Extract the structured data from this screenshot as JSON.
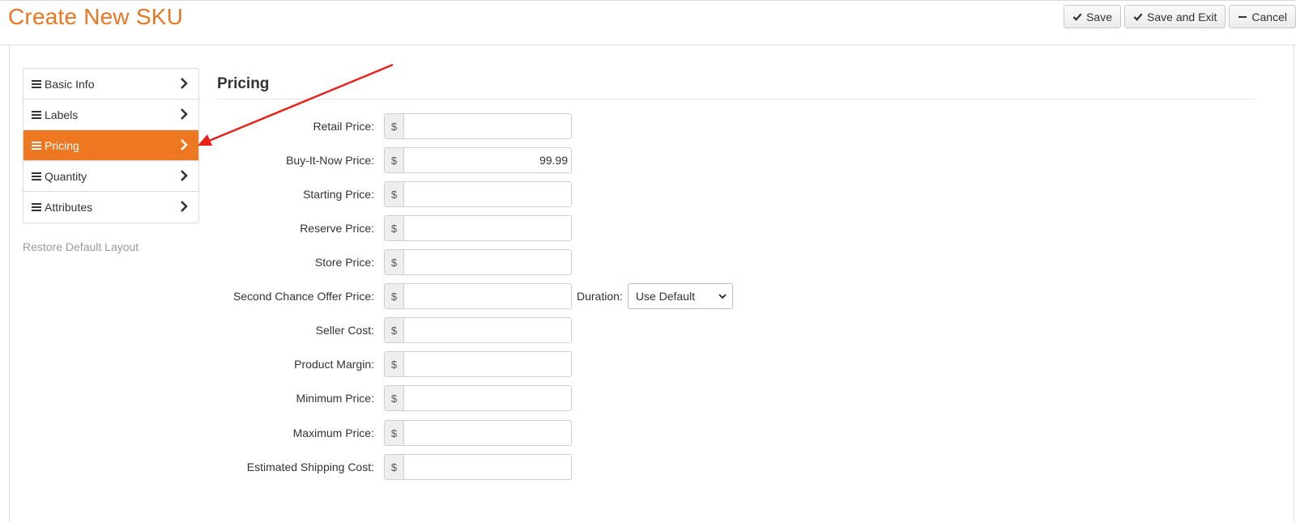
{
  "header": {
    "title": "Create New SKU",
    "save_label": "Save",
    "save_exit_label": "Save and Exit",
    "cancel_label": "Cancel"
  },
  "sidebar": {
    "items": [
      {
        "label": "Basic Info",
        "active": false
      },
      {
        "label": "Labels",
        "active": false
      },
      {
        "label": "Pricing",
        "active": true
      },
      {
        "label": "Quantity",
        "active": false
      },
      {
        "label": "Attributes",
        "active": false
      }
    ],
    "restore_label": "Restore Default Layout",
    "accent_color": "#ee7722"
  },
  "section": {
    "title": "Pricing"
  },
  "fields": [
    {
      "label": "Retail Price:",
      "currency": "$",
      "value": ""
    },
    {
      "label": "Buy-It-Now Price:",
      "currency": "$",
      "value": "99.99"
    },
    {
      "label": "Starting Price:",
      "currency": "$",
      "value": ""
    },
    {
      "label": "Reserve Price:",
      "currency": "$",
      "value": ""
    },
    {
      "label": "Store Price:",
      "currency": "$",
      "value": ""
    },
    {
      "label": "Second Chance Offer Price:",
      "currency": "$",
      "value": ""
    },
    {
      "label": "Seller Cost:",
      "currency": "$",
      "value": ""
    },
    {
      "label": "Product Margin:",
      "currency": "$",
      "value": ""
    },
    {
      "label": "Minimum Price:",
      "currency": "$",
      "value": ""
    },
    {
      "label": "Maximum Price:",
      "currency": "$",
      "value": ""
    },
    {
      "label": "Estimated Shipping Cost:",
      "currency": "$",
      "value": ""
    }
  ],
  "duration": {
    "label": "Duration:",
    "selected": "Use Default"
  },
  "colors": {
    "title": "#e87722",
    "annotation_arrow": "#e8201a"
  }
}
